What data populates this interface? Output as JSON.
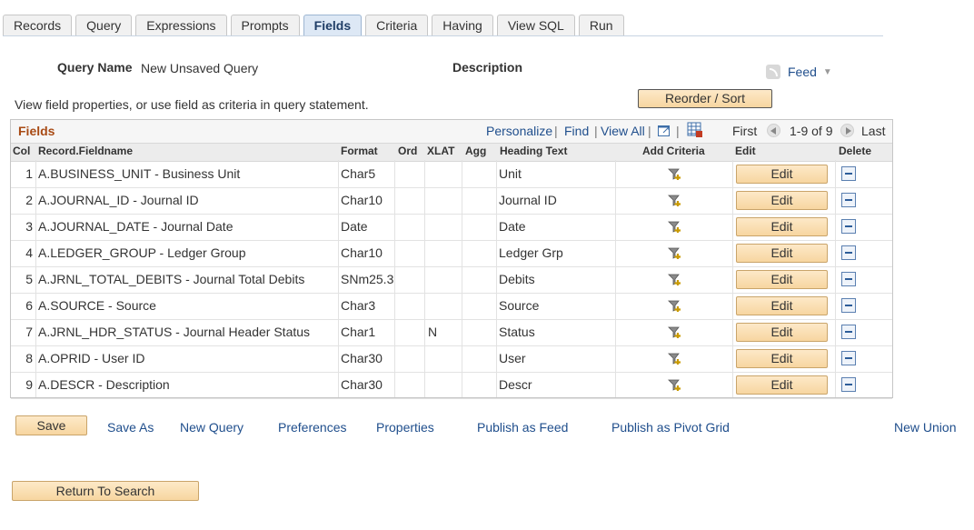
{
  "tabs": [
    "Records",
    "Query",
    "Expressions",
    "Prompts",
    "Fields",
    "Criteria",
    "Having",
    "View SQL",
    "Run"
  ],
  "active_tab": "Fields",
  "query_name_label": "Query Name",
  "query_name_value": "New Unsaved Query",
  "description_label": "Description",
  "feed_label": "Feed",
  "reorder_button": "Reorder / Sort",
  "instruction": "View field properties, or use field as criteria in query statement.",
  "grid": {
    "title": "Fields",
    "personalize": "Personalize",
    "find": "Find",
    "view_all": "View All",
    "first": "First",
    "range": "1-9 of 9",
    "last": "Last",
    "columns": [
      "Col",
      "Record.Fieldname",
      "Format",
      "Ord",
      "XLAT",
      "Agg",
      "Heading Text",
      "Add Criteria",
      "Edit",
      "Delete"
    ],
    "edit_label": "Edit",
    "rows": [
      {
        "col": "1",
        "field": "A.BUSINESS_UNIT - Business Unit",
        "format": "Char5",
        "ord": "",
        "xlat": "",
        "agg": "",
        "heading": "Unit"
      },
      {
        "col": "2",
        "field": "A.JOURNAL_ID - Journal ID",
        "format": "Char10",
        "ord": "",
        "xlat": "",
        "agg": "",
        "heading": "Journal ID"
      },
      {
        "col": "3",
        "field": "A.JOURNAL_DATE - Journal Date",
        "format": "Date",
        "ord": "",
        "xlat": "",
        "agg": "",
        "heading": "Date"
      },
      {
        "col": "4",
        "field": "A.LEDGER_GROUP - Ledger Group",
        "format": "Char10",
        "ord": "",
        "xlat": "",
        "agg": "",
        "heading": "Ledger Grp"
      },
      {
        "col": "5",
        "field": "A.JRNL_TOTAL_DEBITS - Journal Total Debits",
        "format": "SNm25.3",
        "ord": "",
        "xlat": "",
        "agg": "",
        "heading": "Debits"
      },
      {
        "col": "6",
        "field": "A.SOURCE - Source",
        "format": "Char3",
        "ord": "",
        "xlat": "",
        "agg": "",
        "heading": "Source"
      },
      {
        "col": "7",
        "field": "A.JRNL_HDR_STATUS - Journal Header Status",
        "format": "Char1",
        "ord": "",
        "xlat": "N",
        "agg": "",
        "heading": "Status"
      },
      {
        "col": "8",
        "field": "A.OPRID - User ID",
        "format": "Char30",
        "ord": "",
        "xlat": "",
        "agg": "",
        "heading": "User"
      },
      {
        "col": "9",
        "field": "A.DESCR - Description",
        "format": "Char30",
        "ord": "",
        "xlat": "",
        "agg": "",
        "heading": "Descr"
      }
    ]
  },
  "bottom": {
    "save": "Save",
    "links": [
      "Save As",
      "New Query",
      "Preferences",
      "Properties",
      "Publish as Feed",
      "Publish as Pivot Grid",
      "New Union"
    ]
  },
  "return_button": "Return To Search",
  "colors": {
    "accent": "#1f4e8c",
    "title": "#a84a14",
    "button": "#f7d6a0"
  }
}
